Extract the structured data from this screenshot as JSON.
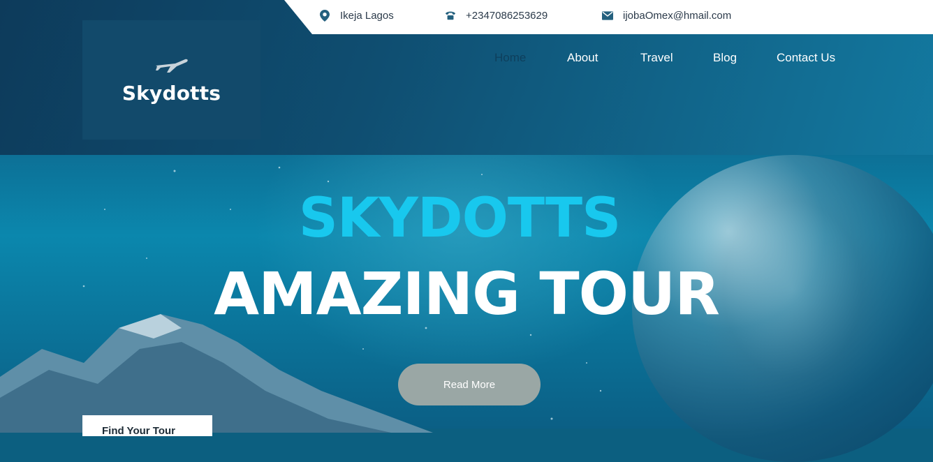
{
  "topbar": {
    "location": "Ikeja Lagos",
    "phone": "+2347086253629",
    "email": "ijobaOmex@hmail.com",
    "location_icon": "map-pin-icon",
    "phone_icon": "telephone-icon",
    "email_icon": "envelope-icon"
  },
  "logo": {
    "text": "Skydotts",
    "icon": "airplane-icon"
  },
  "nav": {
    "items": [
      {
        "label": "Home",
        "active": true
      },
      {
        "label": "About"
      },
      {
        "label": "Travel"
      },
      {
        "label": "Blog"
      },
      {
        "label": "Contact Us"
      }
    ]
  },
  "hero": {
    "title_line1": "SKYDOTTS",
    "title_line2": "AMAZING TOUR",
    "button_label": "Read More",
    "find_tour_label": "Find Your Tour"
  },
  "colors": {
    "accent": "#18c8ee",
    "header_dark": "#0d3a5a",
    "button": "#9aa7a5",
    "active_nav": "#0e3f5c"
  }
}
